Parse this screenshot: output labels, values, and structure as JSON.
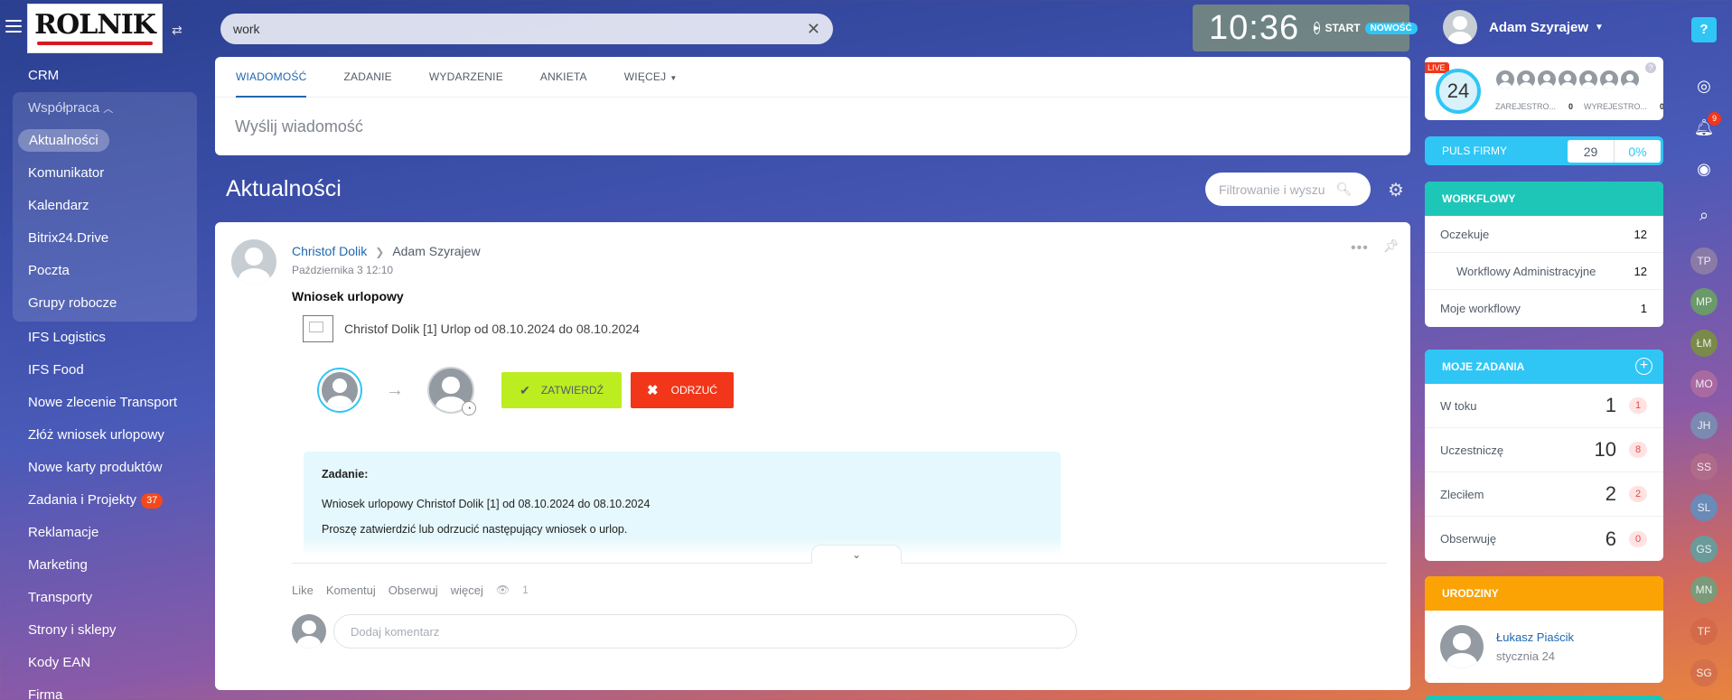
{
  "brand": {
    "logo_text": "ROLNIK"
  },
  "sidebar": {
    "items_top": [
      {
        "label": "CRM"
      }
    ],
    "group": {
      "label": "Współpraca",
      "items": [
        {
          "label": "Aktualności"
        },
        {
          "label": "Komunikator"
        },
        {
          "label": "Kalendarz"
        },
        {
          "label": "Bitrix24.Drive"
        },
        {
          "label": "Poczta"
        },
        {
          "label": "Grupy robocze"
        }
      ]
    },
    "items": [
      {
        "label": "IFS Logistics"
      },
      {
        "label": "IFS Food"
      },
      {
        "label": "Nowe zlecenie Transport"
      },
      {
        "label": "Złóż wniosek urlopowy"
      },
      {
        "label": "Nowe karty produktów"
      },
      {
        "label": "Zadania i Projekty",
        "badge": "37"
      },
      {
        "label": "Reklamacje"
      },
      {
        "label": "Marketing"
      },
      {
        "label": "Transporty"
      },
      {
        "label": "Strony i sklepy"
      },
      {
        "label": "Kody EAN"
      },
      {
        "label": "Firma"
      }
    ]
  },
  "search": {
    "value": "work"
  },
  "clock": {
    "time": "10:36",
    "start_label": "START",
    "new_label": "NOWOŚĆ"
  },
  "user": {
    "name": "Adam Szyrajew"
  },
  "compose": {
    "tabs": [
      {
        "label": "WIADOMOŚĆ"
      },
      {
        "label": "ZADANIE"
      },
      {
        "label": "WYDARZENIE"
      },
      {
        "label": "ANKIETA"
      },
      {
        "label": "WIĘCEJ"
      }
    ],
    "placeholder": "Wyślij wiadomość"
  },
  "feed": {
    "title": "Aktualności",
    "filter_placeholder": "Filtrowanie i wyszu"
  },
  "post": {
    "author": "Christof Dolik",
    "recipient": "Adam Szyrajew",
    "date": "Października 3 12:10",
    "headline": "Wniosek urlopowy",
    "document": "Christof Dolik [1] Urlop od 08.10.2024 do 08.10.2024",
    "approve_label": "ZATWIERDŹ",
    "reject_label": "ODRZUĆ",
    "task_title": "Zadanie:",
    "task_line1": "Wniosek urlopowy Christof Dolik [1] od 08.10.2024 do 08.10.2024",
    "task_line2": "Proszę zatwierdzić lub odrzucić następujący wniosek o urlop.",
    "actions": {
      "like": "Like",
      "comment": "Komentuj",
      "follow": "Obserwuj",
      "more": "więcej",
      "views": "1"
    },
    "comment_placeholder": "Dodaj komentarz"
  },
  "live": {
    "tag": "LIVE",
    "count": "24",
    "registered_label": "ZAREJESTRO...",
    "registered_value": "0",
    "logged_out_label": "WYREJESTRO...",
    "logged_out_value": "0"
  },
  "puls": {
    "label": "PULS FIRMY",
    "value": "29",
    "percent": "0%"
  },
  "workflow": {
    "title": "WORKFLOWY",
    "rows": [
      {
        "label": "Oczekuje",
        "value": "12"
      },
      {
        "label": "Workflowy Administracyjne",
        "value": "12"
      },
      {
        "label": "Moje workflowy",
        "value": "1"
      }
    ]
  },
  "tasks": {
    "title": "MOJE ZADANIA",
    "rows": [
      {
        "label": "W toku",
        "value": "1",
        "count": "1"
      },
      {
        "label": "Uczestniczę",
        "value": "10",
        "count": "8"
      },
      {
        "label": "Zleciłem",
        "value": "2",
        "count": "2"
      },
      {
        "label": "Obserwuję",
        "value": "6",
        "count": "0"
      }
    ]
  },
  "birthdays": {
    "title": "URODZINY",
    "name": "Łukasz Piaścik",
    "date": "stycznia 24"
  },
  "right_strip": {
    "notifications_badge": "9",
    "initials": [
      "TP",
      "MP",
      "ŁM",
      "MO",
      "JH",
      "SS",
      "SL",
      "GS",
      "MN",
      "TF",
      "SG"
    ]
  },
  "colors": {
    "accent": "#2fc6f6",
    "workflow": "#1ec6b8",
    "birthdays": "#fba305",
    "approve": "#bbed21",
    "reject": "#f1361a",
    "link": "#2067b0"
  }
}
